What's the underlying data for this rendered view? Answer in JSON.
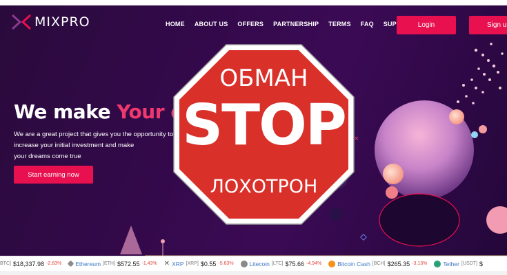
{
  "header": {
    "logo_text": "MIXPRO",
    "nav": [
      "HOME",
      "ABOUT US",
      "OFFERS",
      "PARTNERSHIP",
      "TERMS",
      "FAQ",
      "SUPPORT"
    ],
    "login_label": "Login",
    "signup_label": "Sign up"
  },
  "hero": {
    "title_main": "We make ",
    "title_accent": "Your dr",
    "text_line1": "We are a great project that gives you the opportunity to",
    "text_line2": "increase your initial investment and make",
    "text_line3": "your dreams come true",
    "cta_label": "Start earning now"
  },
  "stop_sign": {
    "top_text": "ОБМАН",
    "main_text": "STOP",
    "bottom_text": "ЛОХОТРОН",
    "color": "#d9302a"
  },
  "ticker": [
    {
      "name": "",
      "symbol": "BTC]",
      "price": "$18,337.98",
      "change": "-2.83%",
      "icon": "bitcoin-icon",
      "color": "#f7931a"
    },
    {
      "name": "Ethereum",
      "symbol": "[ETH]",
      "price": "$572.55",
      "change": "-1.43%",
      "icon": "ethereum-icon",
      "color": "#8c8c8c"
    },
    {
      "name": "XRP",
      "symbol": "[XRP]",
      "price": "$0.55",
      "change": "-5.63%",
      "icon": "xrp-icon",
      "color": "#555555"
    },
    {
      "name": "Litecoin",
      "symbol": "[LTC]",
      "price": "$75.66",
      "change": "-4.94%",
      "icon": "litecoin-icon",
      "color": "#8a8a8a"
    },
    {
      "name": "Bitcoin Cash",
      "symbol": "[BCH]",
      "price": "$265.35",
      "change": "-3.13%",
      "icon": "bitcoin-cash-icon",
      "color": "#f7931a"
    },
    {
      "name": "Tether",
      "symbol": "[USDT]",
      "price": "$",
      "change": "",
      "icon": "tether-icon",
      "color": "#26a17b"
    }
  ],
  "colors": {
    "accent": "#e8104f",
    "background": "#2f0944"
  }
}
